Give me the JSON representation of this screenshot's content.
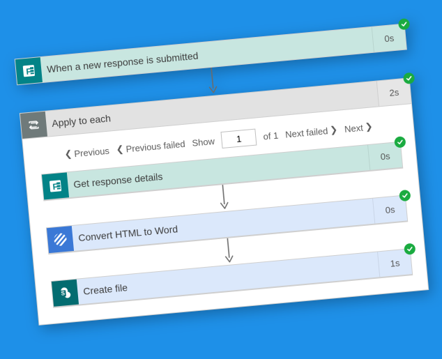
{
  "trigger": {
    "title": "When a new response is submitted",
    "duration": "0s"
  },
  "loop": {
    "title": "Apply to each",
    "duration": "2s",
    "pager": {
      "prev": "Previous",
      "prev_failed": "Previous failed",
      "show": "Show",
      "current": "1",
      "of": "of 1",
      "next_failed": "Next failed",
      "next": "Next"
    },
    "actions": [
      {
        "title": "Get response details",
        "duration": "0s"
      },
      {
        "title": "Convert HTML to Word",
        "duration": "0s"
      },
      {
        "title": "Create file",
        "duration": "1s"
      }
    ]
  }
}
